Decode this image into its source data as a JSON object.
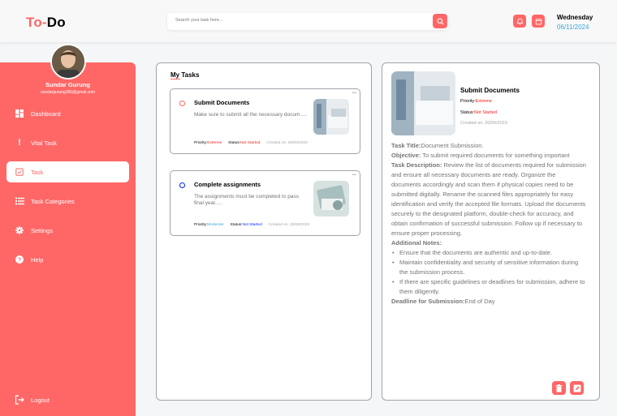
{
  "app": {
    "logo_a": "To",
    "logo_sep": "-",
    "logo_b": "Do"
  },
  "search": {
    "placeholder": "Search your task here..."
  },
  "header": {
    "day": "Wednesday",
    "date": "06/11/2024"
  },
  "user": {
    "name": "Sundar Gurung",
    "email": "sundargurung360@gmail.com"
  },
  "sidebar": {
    "items": [
      {
        "label": "Dashboard",
        "icon": "dashboard-icon"
      },
      {
        "label": "Vital Task",
        "icon": "exclamation-icon"
      },
      {
        "label": "Task",
        "icon": "task-check-icon"
      },
      {
        "label": "Task Categories",
        "icon": "list-icon"
      },
      {
        "label": "Settings",
        "icon": "gear-icon"
      },
      {
        "label": "Help",
        "icon": "help-icon"
      }
    ],
    "logout": "Logout"
  },
  "tasks": {
    "title": "My Tasks",
    "cards": [
      {
        "title": "Submit Documents",
        "desc": "Make sure to submit all the necessary docum.....",
        "priority_label": "Priority:",
        "priority": "Extreme",
        "status_label": "Status:",
        "status": "Not Started",
        "created": "Created on: 20/06/2023",
        "dots": "•••"
      },
      {
        "title": "Complete assignments",
        "desc": "The assignments must be completed to pass final year.....",
        "priority_label": "Priority:",
        "priority": "Moderate",
        "status_label": "Status:",
        "status": "Not Started",
        "created": "Created on: 20/06/2023",
        "dots": "•••"
      }
    ]
  },
  "detail": {
    "title": "Submit Documents",
    "priority_label": "Priority:",
    "priority": "Extreme",
    "status_label": "Status:",
    "status": "Not Started",
    "created": "Created on: 20/06/2023",
    "task_title_label": "Task Title:",
    "task_title": "Document Submission.",
    "objective_label": "Objective:",
    "objective": "To submit required documents for something important",
    "desc_label": "Task Description:",
    "desc": "Review the list of documents required for submission and ensure all necessary documents are ready. Organize the documents accordingly and scan them if physical copies need to be submitted digitally. Rename the scanned files appropriately for easy identification and verify the accepted file formats. Upload the documents securely to the designated platform, double-check for accuracy, and obtain confirmation of successful submission. Follow up if necessary to ensure proper processing.",
    "notes_label": "Additional Notes:",
    "notes": [
      "Ensure that the documents are authentic and up-to-date.",
      "Maintain confidentiality and security of sensitive information during the submission process.",
      "If there are specific guidelines or deadlines for submission, adhere to them diligently."
    ],
    "deadline_label": "Deadline for Submission:",
    "deadline": "End of Day"
  },
  "colors": {
    "accent": "#ff6767",
    "extreme": "#f21e1e",
    "moderate": "#3aa7e0",
    "not_started": "#f21e1e",
    "date": "#3aa7e0",
    "muted": "#747474"
  }
}
